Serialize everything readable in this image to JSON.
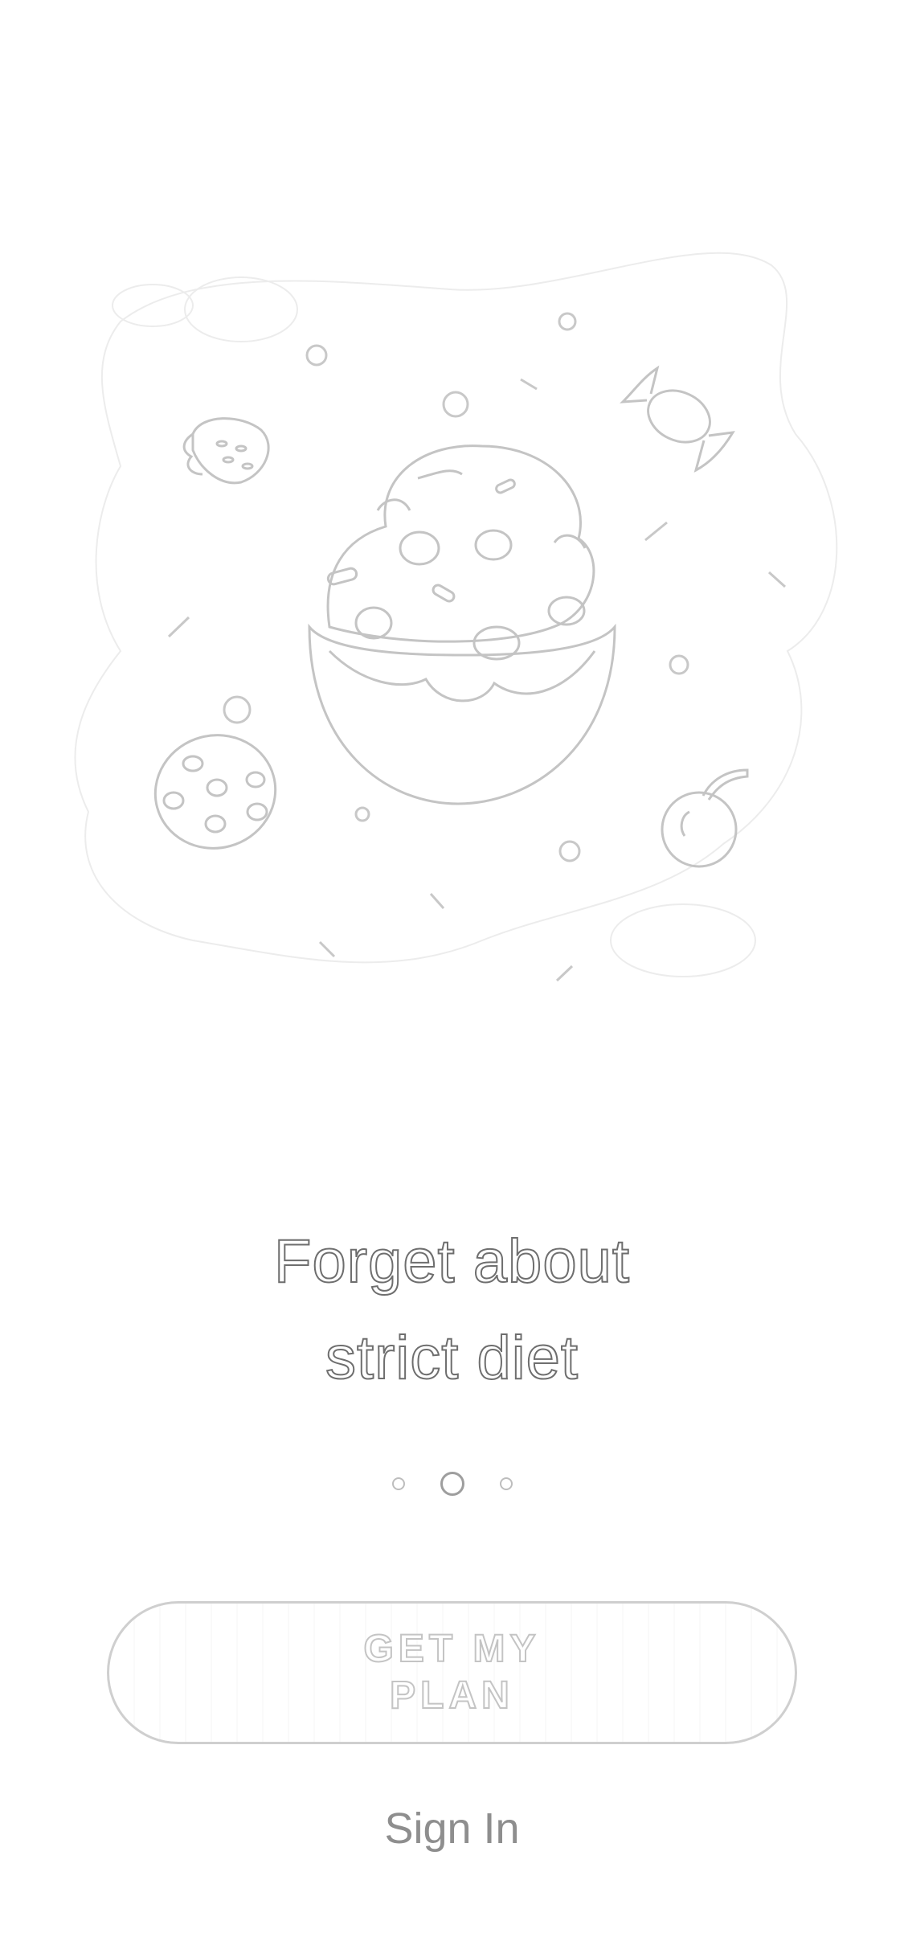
{
  "onboarding": {
    "illustration_icon": "cupcake-sweets-illustration",
    "headline_line1": "Forget about",
    "headline_line2": "strict diet",
    "pager": {
      "count": 3,
      "active_index": 1
    },
    "primary_button_label": "GET MY PLAN",
    "secondary_link_label": "Sign In"
  },
  "colors": {
    "background": "#ffffff",
    "outline": "#c8c8c8",
    "headline_stroke": "#6e6e6e",
    "link_text": "#8e8e8e"
  }
}
